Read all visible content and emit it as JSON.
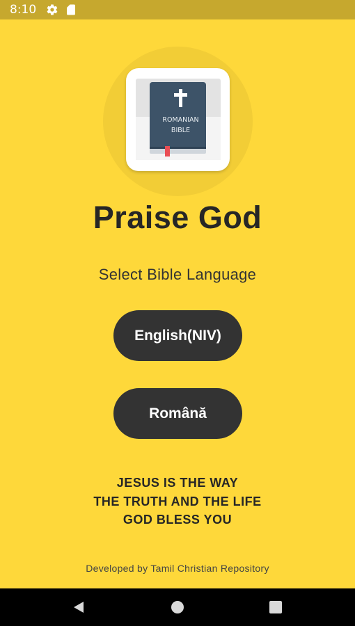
{
  "status_bar": {
    "time": "8:10",
    "icons": [
      "gear-icon",
      "sd-card-icon"
    ]
  },
  "logo": {
    "book_line1": "ROMANIAN",
    "book_line2": "BIBLE"
  },
  "title": "Praise God",
  "subtitle": "Select Bible Language",
  "buttons": {
    "english": "English(NIV)",
    "romana": "Română"
  },
  "motto": {
    "line1": "JESUS IS THE WAY",
    "line2": "THE TRUTH AND THE LIFE",
    "line3": "GOD BLESS YOU"
  },
  "credit": "Developed by Tamil Christian Repository",
  "nav_bar": {
    "icons": [
      "back-icon",
      "home-icon",
      "recents-icon"
    ]
  },
  "colors": {
    "background": "#fed83a",
    "status_bar": "#c6a82e",
    "button": "#333333",
    "book_cover": "#3d5368",
    "bookmark": "#e94e55"
  }
}
